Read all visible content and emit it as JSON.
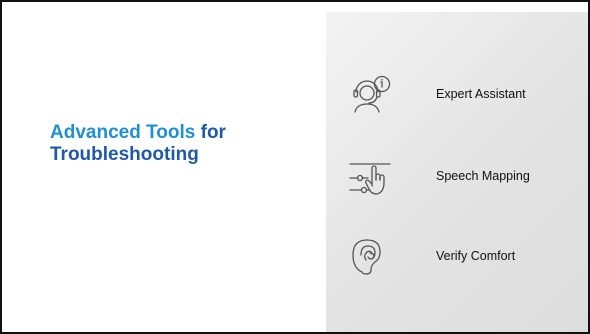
{
  "slide": {
    "title_part1": "Advanced Tools",
    "title_part2": " for Troubleshooting",
    "title_colors": {
      "part1": "#1f8fd6",
      "part2": "#1f5aa8"
    },
    "items": [
      {
        "label": "Expert Assistant",
        "icon": "support-agent-icon"
      },
      {
        "label": "Speech Mapping",
        "icon": "slider-hand-icon"
      },
      {
        "label": "Verify Comfort",
        "icon": "ear-icon"
      }
    ]
  }
}
